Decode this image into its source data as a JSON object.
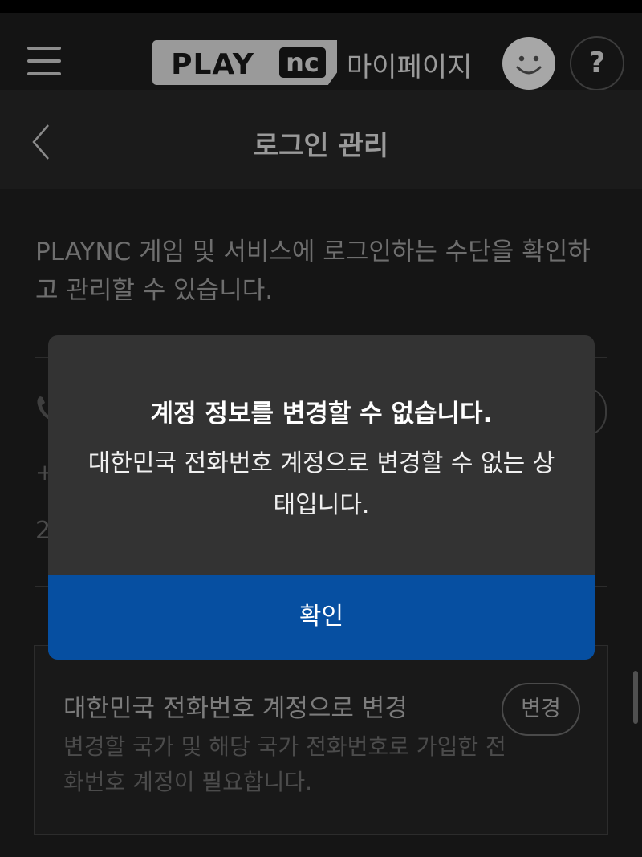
{
  "header": {
    "logo_play": "PLAY",
    "logo_nc": "nc",
    "mypage_label": "마이페이지",
    "help_label": "?"
  },
  "subheader": {
    "title": "로그인 관리"
  },
  "intro": {
    "description": "PLAYNC 게임 및 서비스에 로그인하는 수단을 확인하고 관리할 수 있습니다."
  },
  "account": {
    "plus_fragment": "+",
    "number_fragment": "2"
  },
  "change_card": {
    "title": "대한민국 전화번호 계정으로 변경",
    "description": "변경할 국가 및 해당 국가 전화번호로 가입한 전화번호 계정이 필요합니다.",
    "button_label": "변경"
  },
  "modal": {
    "title": "계정 정보를 변경할 수 없습니다.",
    "message": "대한민국 전화번호 계정으로 변경할 수 없는 상태입니다.",
    "confirm_label": "확인"
  },
  "colors": {
    "background": "#151515",
    "modal_bg": "#333333",
    "confirm_blue": "#064fa1"
  }
}
